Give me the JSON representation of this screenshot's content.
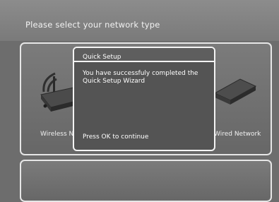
{
  "header": {
    "title": "Please select your network type"
  },
  "options": [
    {
      "label": "Wireless Network",
      "icon": "wireless-router-icon"
    },
    {
      "label": "Wired Network",
      "icon": "wired-router-icon"
    }
  ],
  "dialog": {
    "title": "Quick Setup",
    "message": "You have successfuly completed the Quick Setup Wizard",
    "hint": "Press OK to continue"
  },
  "colors": {
    "background": "#6d6d6d",
    "header": "#7f7f7f",
    "dialog_bg": "#545454",
    "border": "#f4f4f4",
    "text": "#ffffff"
  }
}
